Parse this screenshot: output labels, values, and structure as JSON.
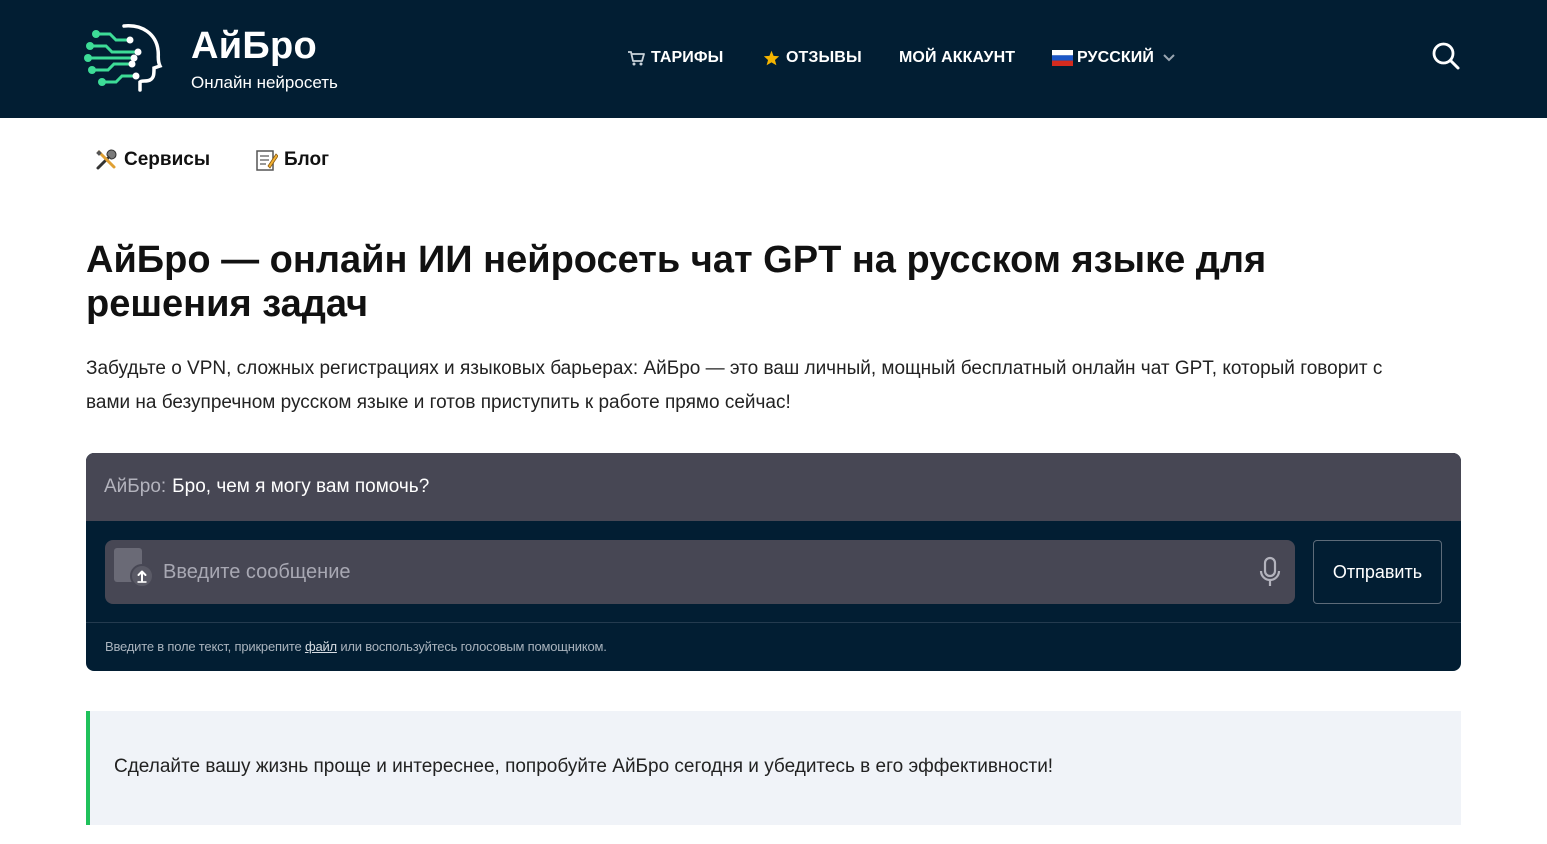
{
  "header": {
    "brand_name": "АйБро",
    "brand_tagline": "Онлайн нейросеть",
    "nav": [
      {
        "label": "ТАРИФЫ",
        "icon": "cart-icon"
      },
      {
        "label": "ОТЗЫВЫ",
        "icon": "star-icon"
      },
      {
        "label": "МОЙ АККАУНТ"
      },
      {
        "label": "РУССКИЙ",
        "icon": "russia-flag-icon"
      }
    ],
    "search_icon": "search-icon"
  },
  "submenu": [
    {
      "label": "Сервисы",
      "icon": "tools-icon"
    },
    {
      "label": "Блог",
      "icon": "memo-icon"
    }
  ],
  "main": {
    "title_line1": "АйБро — онлайн ИИ нейросеть чат GPT на русском языке для",
    "title_line2": "решения задач",
    "intro_line1": "Забудьте о VPN, сложных регистрациях и языковых барьерах: АйБро — это ваш личный, мощный бесплатный онлайн чат GPT, который говорит с",
    "intro_line2": "вами на безупречном русском языке и готов приступить к работе прямо сейчас!"
  },
  "chat": {
    "sender": "АйБро:",
    "message": "Бро, чем я могу вам помочь?",
    "input_placeholder": "Введите сообщение",
    "input_value": "",
    "send_label": "Отправить",
    "hint_before": "Введите в поле текст, прикрепите ",
    "hint_link": "файл",
    "hint_after": " или воспользуйтесь голосовым помощником."
  },
  "callout": {
    "text": "Сделайте вашу жизнь проще и интереснее, попробуйте АйБро сегодня и убедитесь в его эффективности!"
  },
  "colors": {
    "header_bg": "#021e33",
    "accent_green": "#1fc15b",
    "chat_bar": "#474754",
    "callout_bg": "#f0f3f8"
  }
}
